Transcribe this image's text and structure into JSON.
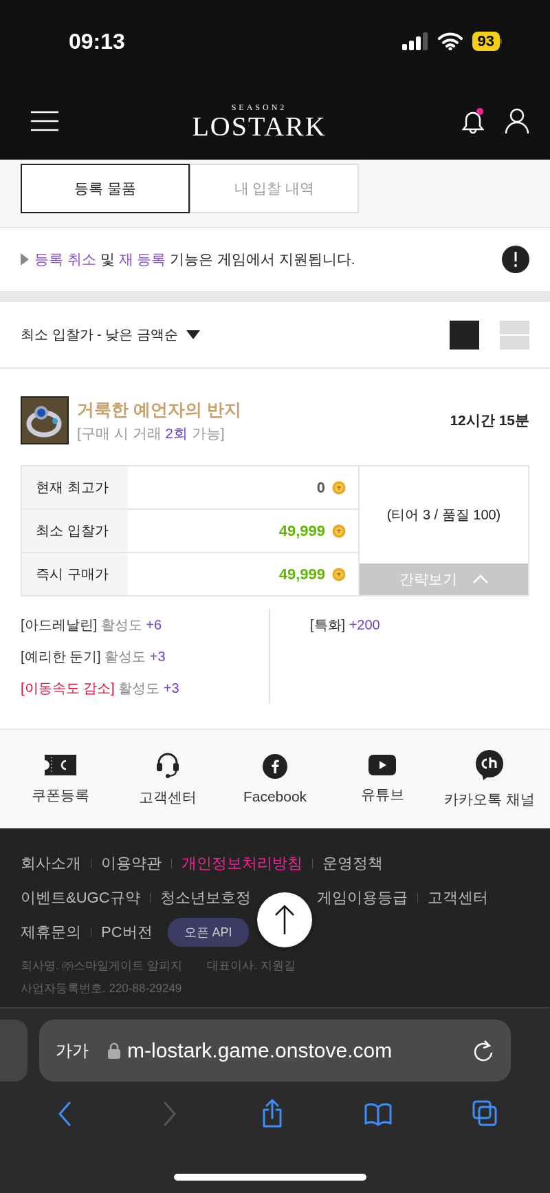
{
  "status_bar": {
    "time": "09:13",
    "battery": "93"
  },
  "header": {
    "logo_top": "SEASON2",
    "logo": "LOSTARK",
    "has_notification": true
  },
  "tabs": [
    {
      "label": "등록 물품",
      "selected": true
    },
    {
      "label": "내 입찰 내역",
      "selected": false
    }
  ],
  "notice": {
    "parts": [
      {
        "text": "등록 취소",
        "kind": "link"
      },
      {
        "text": " 및 ",
        "kind": "text"
      },
      {
        "text": "재 등록",
        "kind": "link"
      },
      {
        "text": " 기능은 게임에서 지원됩니다.",
        "kind": "text"
      }
    ]
  },
  "sort": {
    "label": "최소 입찰가 - 낮은 금액순"
  },
  "view_modes": [
    {
      "kind": "grid",
      "selected": true
    },
    {
      "kind": "list",
      "selected": false
    }
  ],
  "item": {
    "name": "거룩한 예언자의 반지",
    "trade_before": "[구매 시 거래 ",
    "trade_count": "2회",
    "trade_after": " 가능]",
    "time_left": "12시간 15분",
    "prices": [
      {
        "label": "현재 최고가",
        "value": "0",
        "color": "#555555"
      },
      {
        "label": "최소 입찰가",
        "value": "49,999",
        "color": "#5fb800"
      },
      {
        "label": "즉시 구매가",
        "value": "49,999",
        "color": "#5fb800"
      }
    ],
    "quality": "(티어 3 / 품질 100)",
    "toggle": {
      "label": "간략보기",
      "expanded": true
    },
    "effects_left": [
      {
        "name": "[아드레날린]",
        "stat": "활성도",
        "value": "+6",
        "negative": false
      },
      {
        "name": "[예리한 둔기]",
        "stat": "활성도",
        "value": "+3",
        "negative": false
      },
      {
        "name": "[이동속도 감소]",
        "stat": "활성도",
        "value": "+3",
        "negative": true
      }
    ],
    "effects_right": [
      {
        "name": "[특화]",
        "value": "+200"
      }
    ]
  },
  "social": [
    {
      "kind": "coupon",
      "label": "쿠폰등록"
    },
    {
      "kind": "headset",
      "label": "고객센터"
    },
    {
      "kind": "facebook",
      "label": "Facebook"
    },
    {
      "kind": "youtube",
      "label": "유튜브"
    },
    {
      "kind": "kakao",
      "label": "카카오톡 채널"
    }
  ],
  "footer": {
    "link_rows": [
      [
        {
          "label": "회사소개",
          "highlight": false
        },
        {
          "label": "이용약관",
          "highlight": false
        },
        {
          "label": "개인정보처리방침",
          "highlight": true
        },
        {
          "label": "운영정책",
          "highlight": false
        }
      ],
      [
        {
          "label": "이벤트&UGC규약",
          "highlight": false
        },
        {
          "label": "청소년보호정",
          "highlight": false
        },
        {
          "label": "게임이용등급",
          "highlight": false
        },
        {
          "label": "고객센터",
          "highlight": false
        }
      ],
      [
        {
          "label": "제휴문의",
          "highlight": false
        },
        {
          "label": "PC버전",
          "highlight": false
        }
      ]
    ],
    "api_button": "오픈 API",
    "company": [
      "회사명. ㈜스마일게이트 알피지",
      "대표이사. 지원길"
    ],
    "registration": "사업자등록번호. 220-88-29249"
  },
  "browser": {
    "text_size": "가가",
    "url": "m-lostark.game.onstove.com",
    "toolbar": [
      {
        "kind": "back",
        "disabled": false
      },
      {
        "kind": "forward",
        "disabled": true
      },
      {
        "kind": "share",
        "disabled": false
      },
      {
        "kind": "bookmarks",
        "disabled": false
      },
      {
        "kind": "tabs",
        "disabled": false
      }
    ]
  }
}
